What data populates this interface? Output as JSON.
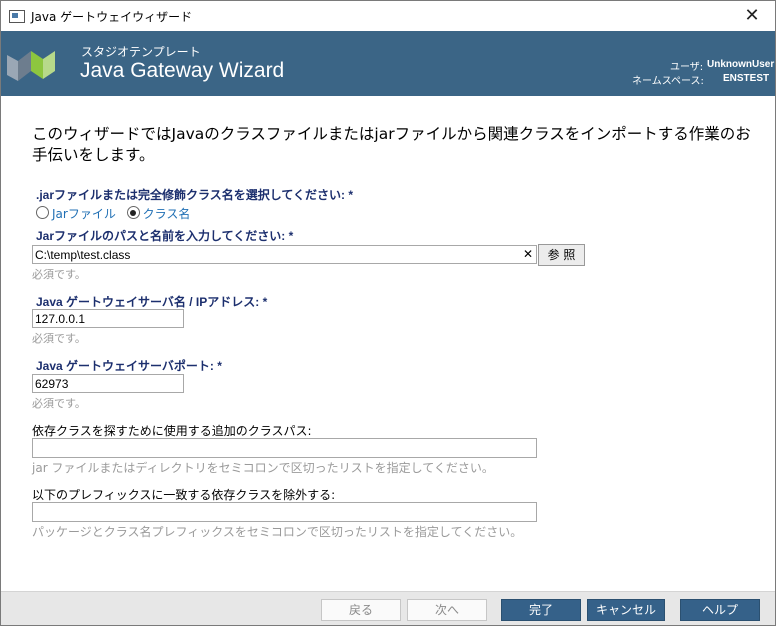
{
  "window": {
    "title": "Java ゲートウェイウィザード",
    "close_glyph": "✕"
  },
  "header": {
    "subtitle": "スタジオテンプレート",
    "title": "Java Gateway Wizard",
    "user_label": "ユーザ:",
    "user_value": "UnknownUser",
    "namespace_label": "ネームスペース:",
    "namespace_value": "ENSTEST",
    "colors": {
      "banner": "#3b6586",
      "logo_gray": "#9aa7b5",
      "logo_green": "#8dc63f"
    }
  },
  "intro": "このウィザードではJavaのクラスファイルまたはjarファイルから関連クラスをインポートする作業のお手伝いをします。",
  "form": {
    "select_label": ".jarファイルまたは完全修飾クラス名を選択してください: *",
    "radio_jar": "Jarファイル",
    "radio_class": "クラス名",
    "selected": "クラス名",
    "path_label": "Jarファイルのパスと名前を入力してください: *",
    "path_value": "C:\\temp\\test.class",
    "clear_glyph": "✕",
    "browse_label": "参 照",
    "required_note": "必須です。",
    "server_label": "Java ゲートウェイサーバ名 / IPアドレス: *",
    "server_value": "127.0.0.1",
    "port_label": "Java ゲートウェイサーバポート: *",
    "port_value": "62973",
    "classpath_label": "依存クラスを探すために使用する追加のクラスパス:",
    "classpath_value": "",
    "classpath_hint": "jar ファイルまたはディレクトリをセミコロンで区切ったリストを指定してください。",
    "exclude_label": "以下のプレフィックスに一致する依存クラスを除外する:",
    "exclude_value": "",
    "exclude_hint": "パッケージとクラス名プレフィックスをセミコロンで区切ったリストを指定してください。"
  },
  "footer": {
    "back": "戻る",
    "next": "次へ",
    "finish": "完了",
    "cancel": "キャンセル",
    "help": "ヘルプ",
    "colors": {
      "primary": "#356189"
    }
  }
}
